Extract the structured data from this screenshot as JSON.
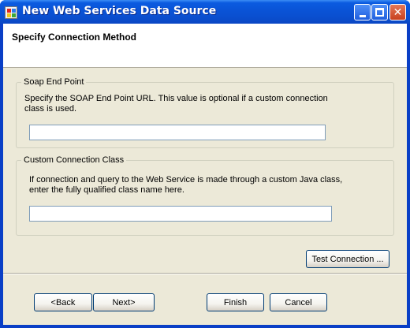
{
  "window": {
    "title": "New Web Services Data Source"
  },
  "header": {
    "title": "Specify Connection Method"
  },
  "soap_group": {
    "legend": "Soap End Point",
    "desc_line1": "Specify the SOAP End Point URL. This value is optional if a custom connection",
    "desc_line2": "class is used.",
    "value": ""
  },
  "custom_group": {
    "legend": "Custom Connection Class",
    "desc_line1": "If connection and query to the Web Service is made through a custom Java class,",
    "desc_line2": "enter the fully qualified class name here.",
    "value": ""
  },
  "buttons": {
    "test_connection": "Test Connection ...",
    "back": "<Back",
    "next": "Next>",
    "finish": "Finish",
    "cancel": "Cancel"
  },
  "colors": {
    "titlebar": "#0a53d6",
    "client_bg": "#ece9d8",
    "close_button": "#c8401d"
  },
  "icons": {
    "app": "windows-app-icon",
    "minimize": "minimize-icon",
    "maximize": "maximize-icon",
    "close": "close-icon"
  }
}
